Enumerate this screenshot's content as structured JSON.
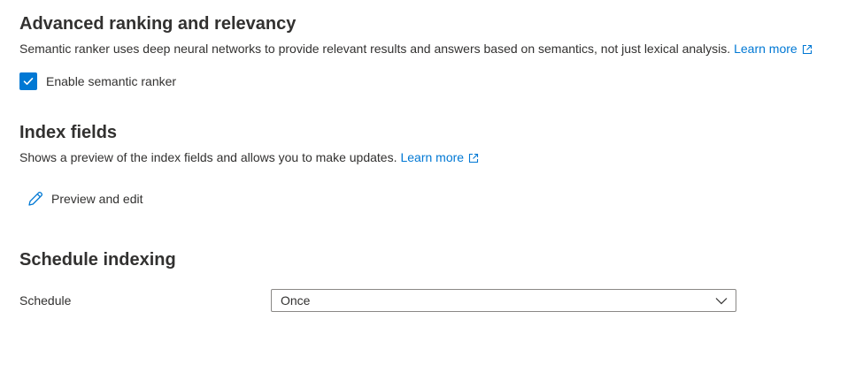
{
  "ranking": {
    "title": "Advanced ranking and relevancy",
    "description": "Semantic ranker uses deep neural networks to provide relevant results and answers based on semantics, not just lexical analysis.",
    "learn_more": "Learn more",
    "checkbox_label": "Enable semantic ranker",
    "checkbox_checked": true
  },
  "index_fields": {
    "title": "Index fields",
    "description": "Shows a preview of the index fields and allows you to make updates.",
    "learn_more": "Learn more",
    "edit_label": "Preview and edit"
  },
  "schedule": {
    "title": "Schedule indexing",
    "field_label": "Schedule",
    "selected": "Once"
  },
  "colors": {
    "accent": "#0078d4",
    "text": "#323130",
    "border": "#8a8886"
  },
  "icons": {
    "external_link": "external-link-icon",
    "checkmark": "checkmark-icon",
    "pencil": "pencil-icon",
    "chevron": "chevron-down-icon"
  }
}
